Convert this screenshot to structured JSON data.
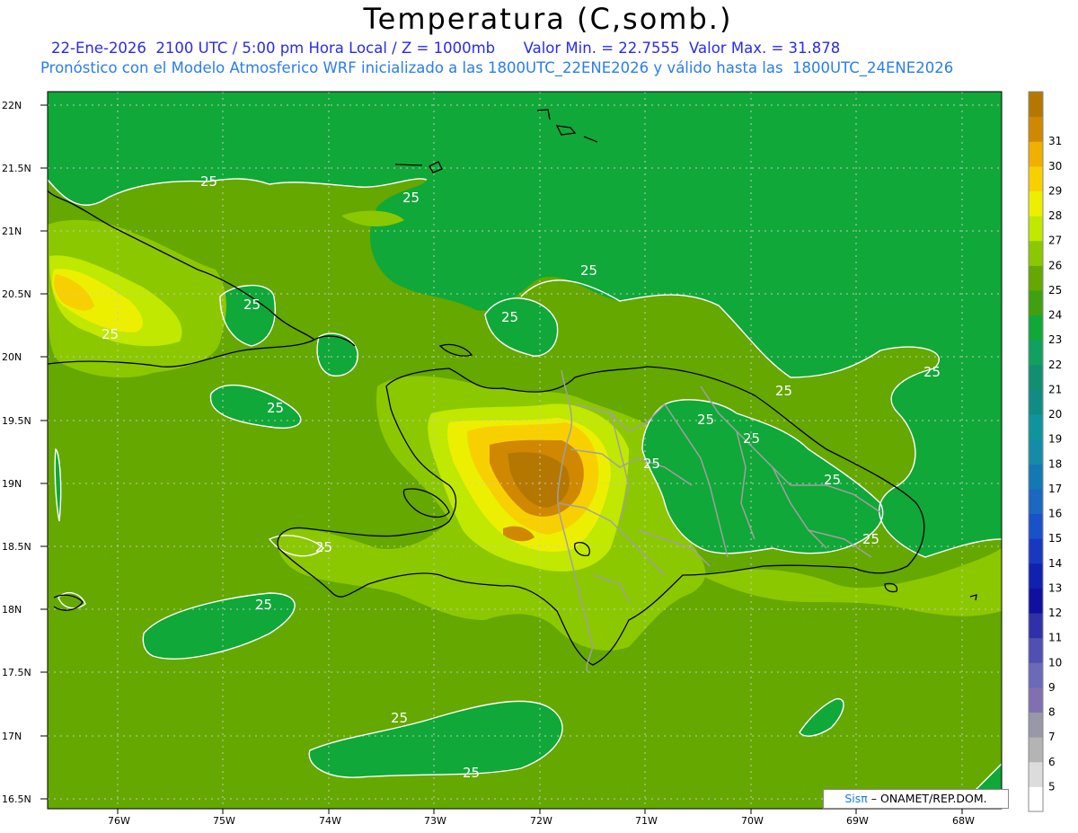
{
  "header": {
    "title": "Temperatura (C,somb.)",
    "line1": "22-Ene-2026  2100 UTC / 5:00 pm Hora Local / Z = 1000mb",
    "min_label": "Valor Min. = 22.7555",
    "max_label": "Valor Max. = 31.878",
    "line2": "Pronóstico con el Modelo Atmosferico WRF inicializado a las 1800UTC_22ENE2026 y válido hasta las  1800UTC_24ENE2026"
  },
  "axes": {
    "lat_labels": [
      "22N",
      "21.5N",
      "21N",
      "20.5N",
      "20N",
      "19.5N",
      "19N",
      "18.5N",
      "18N",
      "17.5N",
      "17N",
      "16.5N"
    ],
    "lon_labels": [
      "76W",
      "75W",
      "74W",
      "73W",
      "72W",
      "71W",
      "70W",
      "69W",
      "68W"
    ]
  },
  "contour_label": "25",
  "colorbar": {
    "levels": [
      "5",
      "6",
      "7",
      "8",
      "9",
      "10",
      "11",
      "12",
      "13",
      "14",
      "15",
      "16",
      "17",
      "18",
      "19",
      "20",
      "21",
      "22",
      "23",
      "24",
      "25",
      "26",
      "27",
      "28",
      "29",
      "30",
      "31"
    ],
    "colors": [
      "#ffffff",
      "#dcdcdc",
      "#b4b4b4",
      "#9898a8",
      "#8070b0",
      "#6a6ab8",
      "#5050b0",
      "#3030a8",
      "#1010a0",
      "#1020b0",
      "#1838c0",
      "#1a50c8",
      "#1a68c0",
      "#1478b4",
      "#148ca8",
      "#10949c",
      "#108c84",
      "#109070",
      "#10a060",
      "#10a838",
      "#40a010",
      "#64a800",
      "#8cc800",
      "#c0e800",
      "#ecf000",
      "#f8d000",
      "#f0b000",
      "#d08800",
      "#b47800"
    ]
  },
  "credit": {
    "logo_text": "Sisπ",
    "org_text": " – ONAMET/REP.DOM."
  }
}
